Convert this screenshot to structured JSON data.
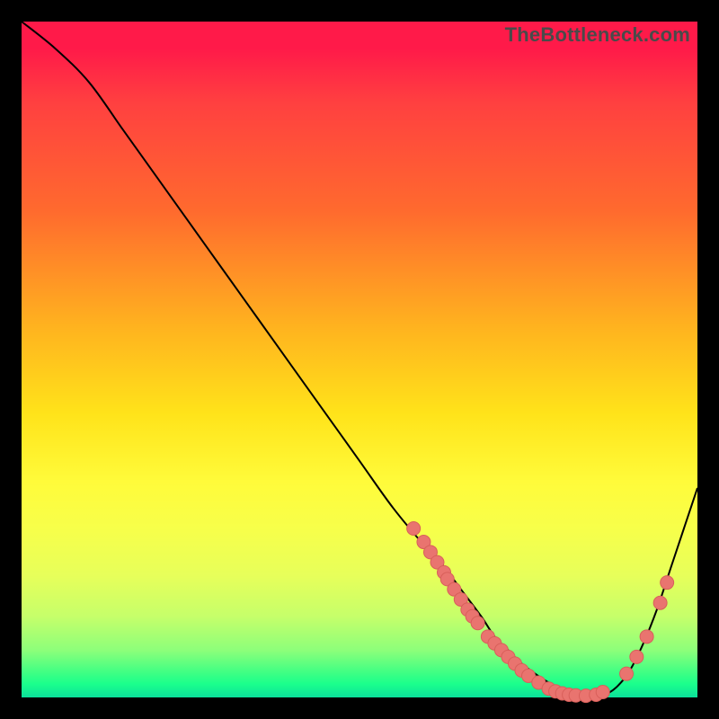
{
  "watermark": "TheBottleneck.com",
  "colors": {
    "curve_stroke": "#000000",
    "dot_fill": "#e9746f",
    "dot_stroke": "#d85f5a"
  },
  "chart_data": {
    "type": "line",
    "title": "",
    "xlabel": "",
    "ylabel": "",
    "xlim": [
      0,
      100
    ],
    "ylim": [
      0,
      100
    ],
    "x": [
      0,
      5,
      10,
      15,
      20,
      25,
      30,
      35,
      40,
      45,
      50,
      55,
      60,
      62,
      65,
      68,
      70,
      72,
      74,
      76,
      78,
      80,
      82,
      84,
      86,
      88,
      90,
      92,
      94,
      96,
      98,
      100
    ],
    "values": [
      100,
      96,
      91,
      84,
      77,
      70,
      63,
      56,
      49,
      42,
      35,
      28,
      22,
      20,
      16,
      12,
      9,
      7,
      5,
      3.5,
      2.2,
      1.2,
      0.5,
      0.2,
      0.3,
      1.5,
      4,
      8,
      13,
      19,
      25,
      31
    ],
    "series_dots": [
      {
        "x": 58,
        "y": 25
      },
      {
        "x": 59.5,
        "y": 23
      },
      {
        "x": 60.5,
        "y": 21.5
      },
      {
        "x": 61.5,
        "y": 20
      },
      {
        "x": 62.5,
        "y": 18.5
      },
      {
        "x": 63,
        "y": 17.5
      },
      {
        "x": 64,
        "y": 16
      },
      {
        "x": 65,
        "y": 14.5
      },
      {
        "x": 66,
        "y": 13
      },
      {
        "x": 66.7,
        "y": 12
      },
      {
        "x": 67.5,
        "y": 11
      },
      {
        "x": 69,
        "y": 9
      },
      {
        "x": 70,
        "y": 8
      },
      {
        "x": 71,
        "y": 7
      },
      {
        "x": 72,
        "y": 6
      },
      {
        "x": 73,
        "y": 5
      },
      {
        "x": 74,
        "y": 4
      },
      {
        "x": 75,
        "y": 3.2
      },
      {
        "x": 76.5,
        "y": 2.2
      },
      {
        "x": 78,
        "y": 1.3
      },
      {
        "x": 79,
        "y": 0.9
      },
      {
        "x": 80,
        "y": 0.6
      },
      {
        "x": 81,
        "y": 0.4
      },
      {
        "x": 82,
        "y": 0.3
      },
      {
        "x": 83.5,
        "y": 0.25
      },
      {
        "x": 85,
        "y": 0.4
      },
      {
        "x": 86,
        "y": 0.8
      },
      {
        "x": 89.5,
        "y": 3.5
      },
      {
        "x": 91,
        "y": 6
      },
      {
        "x": 92.5,
        "y": 9
      },
      {
        "x": 94.5,
        "y": 14
      },
      {
        "x": 95.5,
        "y": 17
      }
    ]
  }
}
